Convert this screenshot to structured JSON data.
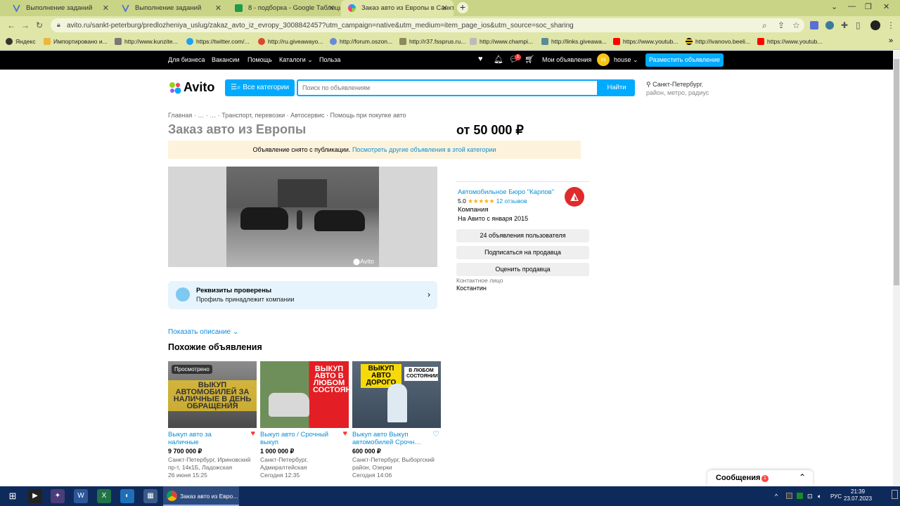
{
  "browser": {
    "tabs": [
      {
        "title": "Выполнение заданий"
      },
      {
        "title": "Выполнение заданий"
      },
      {
        "title": "8 - подборка - Google Таблицы"
      },
      {
        "title": "Заказ авто из Европы в Санкт-Пе"
      }
    ],
    "url": "avito.ru/sankt-peterburg/predlozheniya_uslug/zakaz_avto_iz_evropy_3008842457?utm_campaign=native&utm_medium=item_page_ios&utm_source=soc_sharing",
    "bookmarks": [
      "Яндекс",
      "Импортировано и...",
      "http://www.kunzite...",
      "https://twitter.com/...",
      "http://ru.giveawayo...",
      "http://forum.oszon...",
      "http://r37.fssprus.ru...",
      "http://www.champi...",
      "http://links.giveawa...",
      "https://www.youtub...",
      "http://ivanovo.beeli...",
      "https://www.youtub..."
    ]
  },
  "topnav": {
    "links": [
      "Для бизнеса",
      "Вакансии",
      "Помощь",
      "Каталоги",
      "Польза"
    ],
    "my_ads": "Мои объявления",
    "user_initial": "H",
    "user": "house",
    "post_button": "Разместить объявление",
    "chat_badge": "1"
  },
  "search": {
    "logo": "Avito",
    "categories_button": "Все категории",
    "placeholder": "Поиск по объявлениям",
    "find_button": "Найти",
    "location_city": "Санкт-Петербург",
    "location_rest": ", район, метро, радиус"
  },
  "item": {
    "breadcrumbs": "Главная  ·  …  ·  …  ·  Транспорт, перевозки  ·  Автосервис  ·  Помощь при покупке авто",
    "title": "Заказ авто из Европы",
    "price": "от 50 000 ₽",
    "notice_text": "Объявление снято с публикации. ",
    "notice_link": "Посмотреть другие объявления в этой категории",
    "watermark": "Avito",
    "verified_title": "Реквизиты проверены",
    "verified_sub": "Профиль принадлежит компании",
    "show_description": "Показать описание"
  },
  "seller": {
    "name": "Автомобильное Бюро \"Карпов\"",
    "rating": "5.0",
    "stars": "★★★★★",
    "reviews": "12 отзывов",
    "type": "Компания",
    "since": "На Авито с января 2015",
    "btn_ads": "24 объявления пользователя",
    "btn_subscribe": "Подписаться на продавца",
    "btn_rate": "Оценить продавца",
    "contact_label": "Контактное лицо",
    "contact_name": "Костантин"
  },
  "similar": {
    "heading": "Похожие объявления",
    "seen_label": "Просмотрено",
    "cards": [
      {
        "title": "Выкуп авто за наличные",
        "price": "9 700 000 ₽",
        "address": "Санкт-Петербург, Ириновский пр-т, 14к1Б, Ладожская",
        "date": "26 июня 15:25",
        "banner": "ВЫКУП АВТОМОБИЛЕЙ ЗА НАЛИЧНЫЕ В ДЕНЬ ОБРАЩЕНИЯ",
        "favorited": true
      },
      {
        "title": "Выкуп авто / Срочный выкуп",
        "price": "1 000 000 ₽",
        "address": "Санкт-Петербург, Адмиралтейская",
        "date": "Сегодня 12:35",
        "banner": "ВЫКУП АВТО В ЛЮБОМ СОСТОЯНИИ",
        "favorited": true
      },
      {
        "title": "Выкуп авто Выкуп автомобилей Срочн…",
        "price": "600 000 ₽",
        "address": "Санкт-Петербург, Выборгский район, Озерки",
        "date": "Сегодня 14:06",
        "banner": "ВЫКУП АВТО ДОРОГО",
        "banner2": "В ЛЮБОМ СОСТОЯНИИ",
        "favorited": false
      }
    ]
  },
  "messages": {
    "label": "Сообщения",
    "badge": "1"
  },
  "taskbar": {
    "app_title": "Заказ авто из Евро...",
    "time": "21:39",
    "date": "23.07.2023",
    "lang": "РУС"
  },
  "colors": {
    "accent": "#00aaff",
    "link": "#0a8fd6",
    "notice_bg": "#fdf3dc",
    "verified_bg": "#e6f4fd",
    "chrome_bg": "#dfe6a8"
  }
}
